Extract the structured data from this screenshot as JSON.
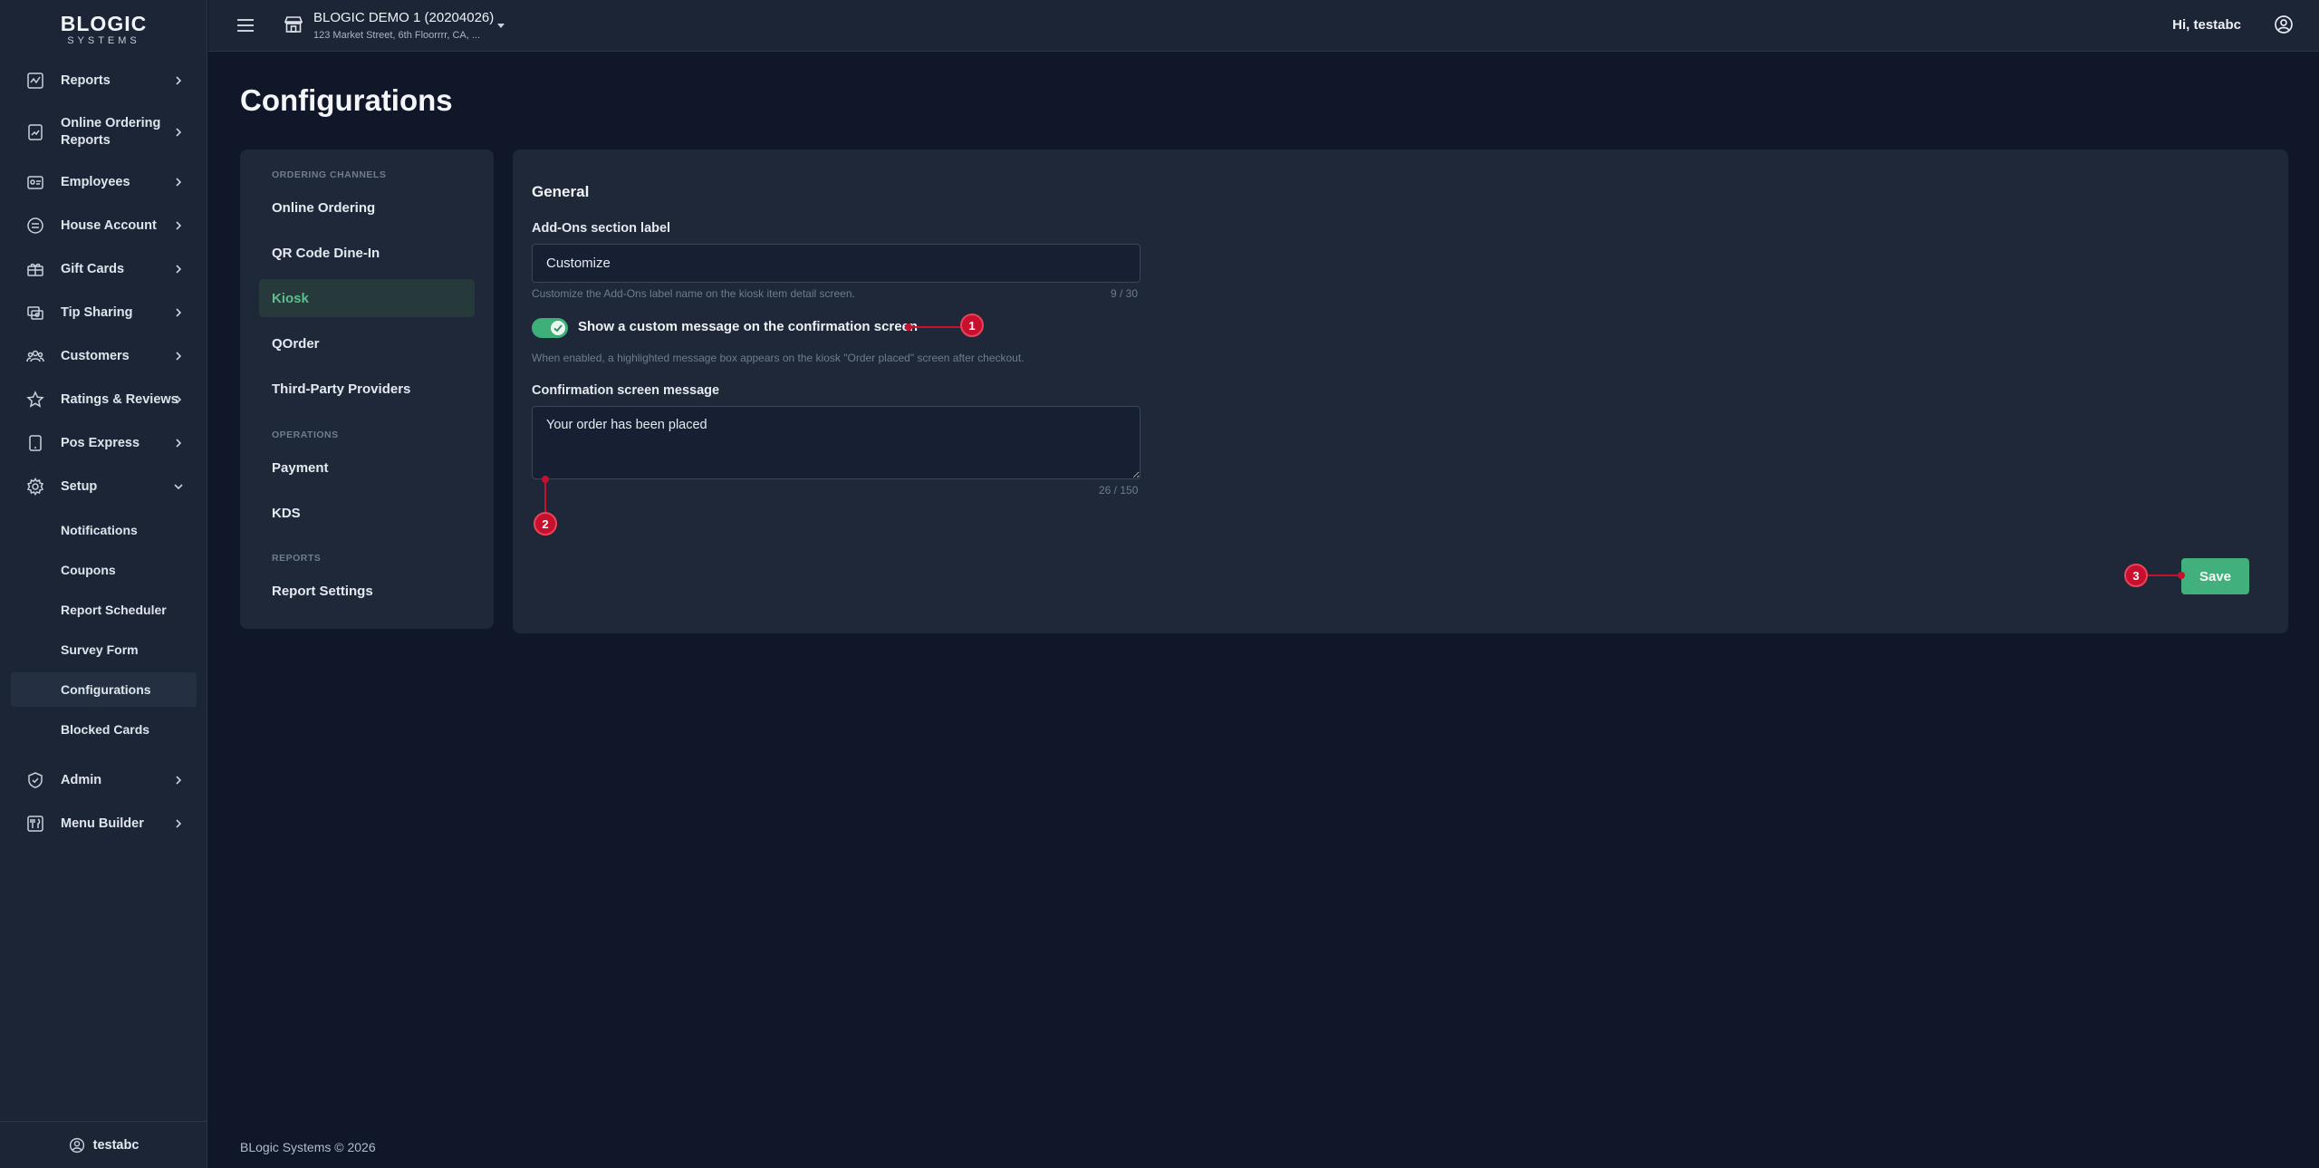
{
  "brand": {
    "name": "BLOGIC",
    "tagline": "SYSTEMS"
  },
  "header": {
    "store_name": "BLOGIC DEMO 1 (20204026)",
    "store_address": "123 Market Street, 6th Floorrrr, CA, ...",
    "greeting": "Hi, testabc"
  },
  "sidebar": {
    "items": [
      {
        "label": "Reports",
        "icon": "chart-line-icon"
      },
      {
        "label": "Online Ordering\nReports",
        "icon": "report-chart-icon"
      },
      {
        "label": "Employees",
        "icon": "id-badge-icon"
      },
      {
        "label": "House Account",
        "icon": "house-account-icon"
      },
      {
        "label": "Gift Cards",
        "icon": "gift-icon"
      },
      {
        "label": "Tip Sharing",
        "icon": "tip-sharing-icon"
      },
      {
        "label": "Customers",
        "icon": "users-icon"
      },
      {
        "label": "Ratings & Reviews",
        "icon": "star-icon"
      },
      {
        "label": "Pos Express",
        "icon": "tablet-icon"
      },
      {
        "label": "Setup",
        "icon": "gear-icon"
      }
    ],
    "setup_subitems": [
      "Notifications",
      "Coupons",
      "Report Scheduler",
      "Survey Form",
      "Configurations",
      "Blocked Cards"
    ],
    "active_subitem": "Configurations",
    "bottom_items": [
      {
        "label": "Admin",
        "icon": "shield-check-icon"
      },
      {
        "label": "Menu Builder",
        "icon": "menu-builder-icon"
      }
    ],
    "user": "testabc"
  },
  "page": {
    "title": "Configurations"
  },
  "config_nav": {
    "sections": [
      {
        "title": "ORDERING CHANNELS",
        "links": [
          "Online Ordering",
          "QR Code Dine-In",
          "Kiosk",
          "QOrder",
          "Third-Party Providers"
        ]
      },
      {
        "title": "OPERATIONS",
        "links": [
          "Payment",
          "KDS"
        ]
      },
      {
        "title": "REPORTS",
        "links": [
          "Report Settings"
        ]
      }
    ],
    "active": "Kiosk"
  },
  "general": {
    "title": "General",
    "addons_label": "Add-Ons section label",
    "addons_value": "Customize",
    "addons_hint": "Customize the Add-Ons label name on the kiosk item detail screen.",
    "addons_counter": "9 / 30",
    "toggle_on": true,
    "toggle_label": "Show a custom message on the confirmation screen",
    "toggle_hint": "When enabled, a highlighted message box appears on the kiosk \"Order placed\" screen after checkout.",
    "message_label": "Confirmation screen message",
    "message_value": "Your order has been placed",
    "message_counter": "26 / 150",
    "save_label": "Save"
  },
  "annotations": [
    "1",
    "2",
    "3"
  ],
  "colors": {
    "accent": "#41b07c",
    "marker": "#c8102e",
    "background": "#0f1729",
    "panel": "#1e2839"
  },
  "footer": "BLogic Systems © 2026"
}
